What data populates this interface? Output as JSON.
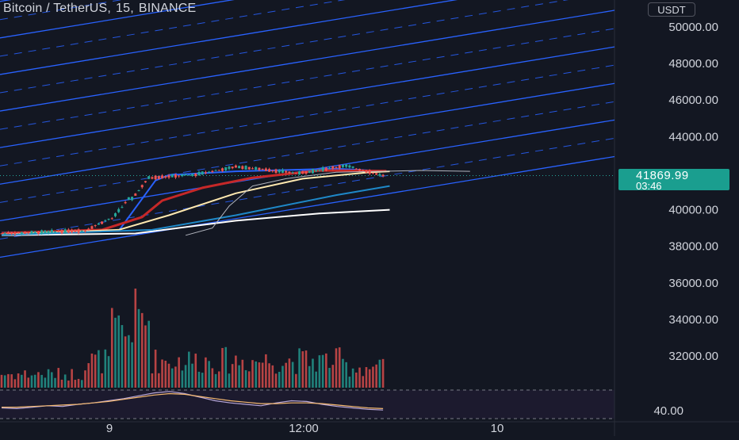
{
  "header": {
    "symbol": "Bitcoin / TetherUS",
    "interval": "15",
    "exchange": "BINANCE"
  },
  "currency_button": "USDT",
  "last_price": {
    "price": "41869.99",
    "countdown": "03:46"
  },
  "colors": {
    "background": "#131722",
    "channel_line": "#2962ff",
    "up": "#26a69a",
    "down": "#ef5350",
    "price_tag": "#1a9e8f",
    "ma_red": "#c62828",
    "ma_blue": "#2962ff",
    "ma_cream": "#ffe9b0",
    "ma_white": "#ffffff",
    "ma_teal": "#1e88c8",
    "ma_gray": "#b2b5be",
    "rsi_line": "#b7a6d9",
    "rsi_signal": "#f5b971"
  },
  "chart_data": [
    {
      "type": "candlestick",
      "ylim": [
        35000,
        51800
      ],
      "y_ticks": [
        "50000.00",
        "48000.00",
        "46000.00",
        "44000.00",
        "40000.00",
        "38000.00",
        "36000.00",
        "34000.00",
        "32000.00"
      ],
      "x_ticks": [
        "9",
        "12:00",
        "10"
      ],
      "price_segments": [
        {
          "bars": 25,
          "start": 38700,
          "end": 38850,
          "vol": 1
        },
        {
          "bars": 8,
          "start": 38850,
          "end": 39500,
          "vol": 2
        },
        {
          "bars": 6,
          "start": 39500,
          "end": 40600,
          "vol": 4
        },
        {
          "bars": 6,
          "start": 40600,
          "end": 41750,
          "vol": 5
        },
        {
          "bars": 12,
          "start": 41750,
          "end": 41900,
          "vol": 2
        },
        {
          "bars": 14,
          "start": 41900,
          "end": 42350,
          "vol": 2
        },
        {
          "bars": 18,
          "start": 42350,
          "end": 42000,
          "vol": 2
        },
        {
          "bars": 14,
          "start": 42000,
          "end": 42400,
          "vol": 2
        },
        {
          "bars": 12,
          "start": 42400,
          "end": 41870,
          "vol": 1.5
        }
      ],
      "overlay_series": [
        {
          "color": "ma_blue",
          "points": [
            [
              0,
              38750
            ],
            [
              35,
              38850
            ],
            [
              46,
              41600
            ],
            [
              50,
              41900
            ],
            [
              70,
              42100
            ],
            [
              100,
              42250
            ],
            [
              115,
              42100
            ]
          ]
        },
        {
          "color": "ma_red",
          "points": [
            [
              0,
              38720
            ],
            [
              30,
              38900
            ],
            [
              42,
              39600
            ],
            [
              48,
              40500
            ],
            [
              60,
              41200
            ],
            [
              75,
              41750
            ],
            [
              95,
              42150
            ],
            [
              115,
              42120
            ]
          ]
        },
        {
          "color": "ma_cream",
          "points": [
            [
              0,
              38650
            ],
            [
              35,
              38900
            ],
            [
              50,
              39700
            ],
            [
              70,
              40900
            ],
            [
              90,
              41700
            ],
            [
              110,
              42050
            ],
            [
              116,
              42100
            ]
          ]
        },
        {
          "color": "ma_white",
          "points": [
            [
              0,
              38600
            ],
            [
              40,
              38700
            ],
            [
              70,
              39400
            ],
            [
              95,
              39800
            ],
            [
              116,
              40000
            ]
          ]
        },
        {
          "color": "ma_teal",
          "points": [
            [
              0,
              38620
            ],
            [
              45,
              38900
            ],
            [
              70,
              39700
            ],
            [
              100,
              40800
            ],
            [
              116,
              41300
            ]
          ]
        },
        {
          "color": "ma_gray",
          "points": [
            [
              55,
              38600
            ],
            [
              63,
              39000
            ],
            [
              68,
              40200
            ],
            [
              75,
              41300
            ],
            [
              85,
              41700
            ],
            [
              100,
              42050
            ],
            [
              125,
              42150
            ],
            [
              140,
              42100
            ]
          ]
        }
      ],
      "channel_lines": {
        "count": 11,
        "start_price": 37400,
        "step": 2000,
        "slope_per_bar": 30,
        "dashed_midlines": true
      }
    },
    {
      "type": "line",
      "name": "RSI",
      "ylim": [
        25,
        80
      ],
      "y_ticks": [
        "40.00"
      ],
      "series": [
        {
          "color": "rsi_line",
          "values": [
            45,
            44,
            46,
            48,
            47,
            50,
            52,
            55,
            58,
            62,
            66,
            68,
            65,
            60,
            55,
            52,
            50,
            48,
            52,
            55,
            54,
            50,
            47,
            45,
            43,
            42
          ]
        },
        {
          "color": "rsi_signal",
          "values": [
            46,
            46,
            47,
            48,
            49,
            50,
            52,
            54,
            57,
            60,
            63,
            65,
            64,
            61,
            58,
            55,
            53,
            51,
            51,
            52,
            52,
            51,
            49,
            47,
            45,
            44
          ]
        }
      ]
    }
  ]
}
